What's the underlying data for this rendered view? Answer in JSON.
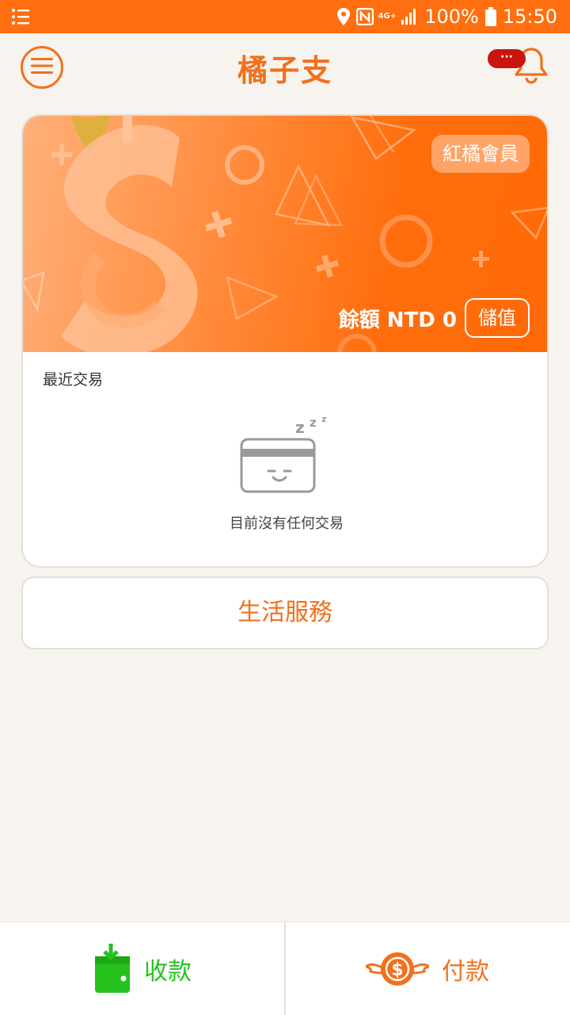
{
  "status_bar": {
    "network": "4G+",
    "battery": "100%",
    "time": "15:50",
    "icons": [
      "list-icon",
      "location-icon",
      "nfc-icon",
      "network-icon",
      "signal-icon",
      "battery-icon"
    ]
  },
  "header": {
    "title": "橘子支",
    "notification_badge": "···"
  },
  "card": {
    "member_level": "紅橘會員",
    "balance_label": "餘額 NTD 0",
    "topup_label": "儲值"
  },
  "recent": {
    "title": "最近交易",
    "empty_text": "目前沒有任何交易",
    "sleep_label": "z z z"
  },
  "life_services": {
    "label": "生活服務"
  },
  "bottom": {
    "receive_label": "收款",
    "pay_label": "付款",
    "pay_icon_symbol": "$"
  },
  "colors": {
    "brand_orange": "#f2701c",
    "status_bar": "#ff6e0f",
    "receive_green": "#25c21e",
    "badge_red": "#c9150f",
    "background": "#f7f3ee"
  }
}
